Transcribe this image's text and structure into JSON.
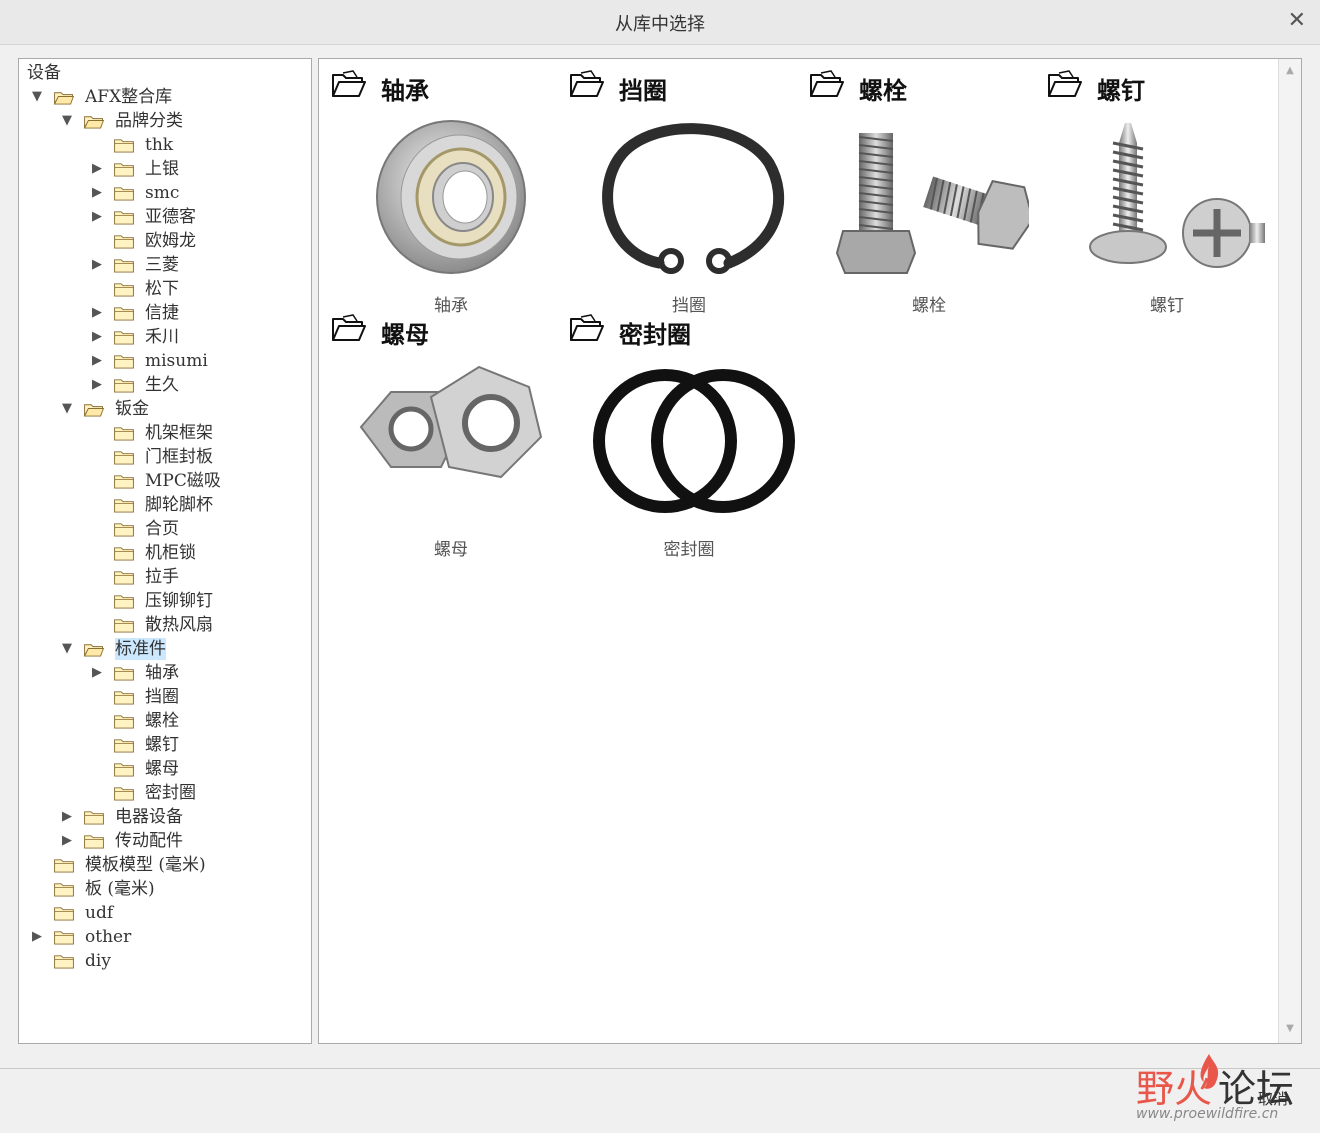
{
  "window": {
    "title": "从库中选择",
    "close_glyph": "✕"
  },
  "tree": {
    "header": "设备",
    "nodes": [
      {
        "label": "AFX整合库",
        "arrow": "▼",
        "level": 0,
        "open": true
      },
      {
        "label": "品牌分类",
        "arrow": "▼",
        "level": 1,
        "open": true
      },
      {
        "label": "thk",
        "arrow": "",
        "level": 2
      },
      {
        "label": "上银",
        "arrow": "▶",
        "level": 2
      },
      {
        "label": "smc",
        "arrow": "▶",
        "level": 2
      },
      {
        "label": "亚德客",
        "arrow": "▶",
        "level": 2
      },
      {
        "label": "欧姆龙",
        "arrow": "",
        "level": 2
      },
      {
        "label": "三菱",
        "arrow": "▶",
        "level": 2
      },
      {
        "label": "松下",
        "arrow": "",
        "level": 2
      },
      {
        "label": "信捷",
        "arrow": "▶",
        "level": 2
      },
      {
        "label": "禾川",
        "arrow": "▶",
        "level": 2
      },
      {
        "label": "misumi",
        "arrow": "▶",
        "level": 2
      },
      {
        "label": "生久",
        "arrow": "▶",
        "level": 2
      },
      {
        "label": "钣金",
        "arrow": "▼",
        "level": 1,
        "open": true
      },
      {
        "label": "机架框架",
        "arrow": "",
        "level": 2
      },
      {
        "label": "门框封板",
        "arrow": "",
        "level": 2
      },
      {
        "label": "MPC磁吸",
        "arrow": "",
        "level": 2
      },
      {
        "label": "脚轮脚杯",
        "arrow": "",
        "level": 2
      },
      {
        "label": "合页",
        "arrow": "",
        "level": 2
      },
      {
        "label": "机柜锁",
        "arrow": "",
        "level": 2
      },
      {
        "label": "拉手",
        "arrow": "",
        "level": 2
      },
      {
        "label": "压铆铆钉",
        "arrow": "",
        "level": 2
      },
      {
        "label": "散热风扇",
        "arrow": "",
        "level": 2
      },
      {
        "label": "标准件",
        "arrow": "▼",
        "level": 1,
        "open": true,
        "selected": true
      },
      {
        "label": "轴承",
        "arrow": "▶",
        "level": 2
      },
      {
        "label": "挡圈",
        "arrow": "",
        "level": 2
      },
      {
        "label": "螺栓",
        "arrow": "",
        "level": 2
      },
      {
        "label": "螺钉",
        "arrow": "",
        "level": 2
      },
      {
        "label": "螺母",
        "arrow": "",
        "level": 2
      },
      {
        "label": "密封圈",
        "arrow": "",
        "level": 2
      },
      {
        "label": "电器设备",
        "arrow": "▶",
        "level": 1
      },
      {
        "label": "传动配件",
        "arrow": "▶",
        "level": 1
      },
      {
        "label": "模板模型 (毫米)",
        "arrow": "",
        "level": 0
      },
      {
        "label": "板 (毫米)",
        "arrow": "",
        "level": 0
      },
      {
        "label": "udf",
        "arrow": "",
        "level": 0
      },
      {
        "label": "other",
        "arrow": "▶",
        "level": 0
      },
      {
        "label": "diy",
        "arrow": "",
        "level": 0
      }
    ]
  },
  "gallery": {
    "items": [
      {
        "heading": "轴承",
        "caption": "轴承",
        "icon": "bearing-image"
      },
      {
        "heading": "挡圈",
        "caption": "挡圈",
        "icon": "retaining-ring-image"
      },
      {
        "heading": "螺栓",
        "caption": "螺栓",
        "icon": "bolt-image"
      },
      {
        "heading": "螺钉",
        "caption": "螺钉",
        "icon": "screw-image"
      },
      {
        "heading": "螺母",
        "caption": "螺母",
        "icon": "nut-image"
      },
      {
        "heading": "密封圈",
        "caption": "密封圈",
        "icon": "o-ring-image"
      }
    ]
  },
  "footer": {
    "cancel_label": "取消"
  },
  "watermark": {
    "brand_a": "野火",
    "brand_b": "论坛",
    "url": "www.proewildfire.cn"
  },
  "colors": {
    "selected_bg": "#cce8ff",
    "folder_fill": "#fff3c4",
    "folder_stroke": "#8a6d2f",
    "watermark_red": "#e8574a"
  }
}
